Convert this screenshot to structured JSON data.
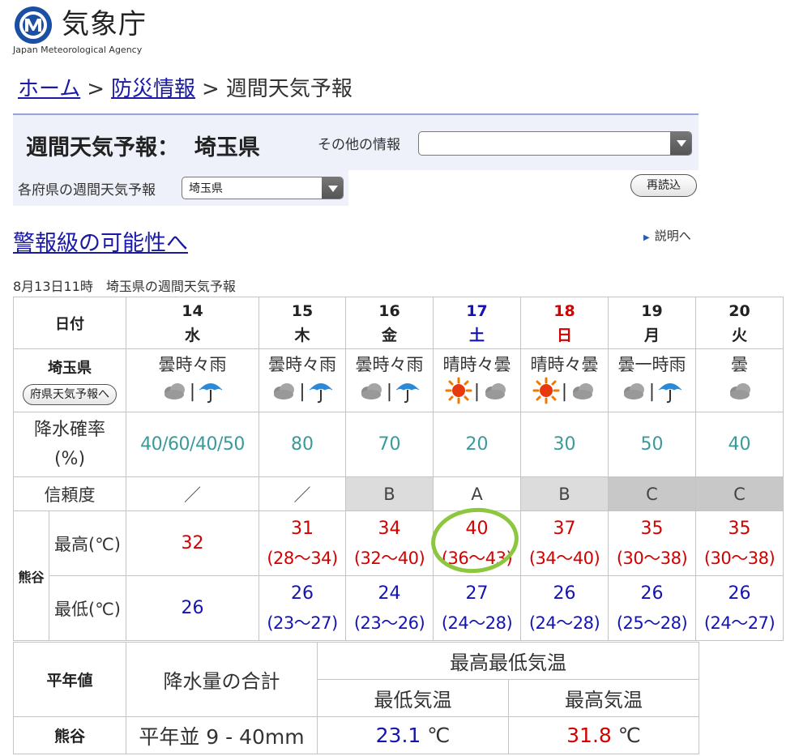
{
  "logo": {
    "jp": "気象庁",
    "en": "Japan Meteorological Agency"
  },
  "breadcrumb": {
    "home": "ホーム",
    "sep1": ">",
    "bosai": "防災情報",
    "sep2": ">",
    "current": "週間天気予報"
  },
  "header": {
    "title": "週間天気予報：  埼玉県",
    "other_info_label": "その他の情報",
    "other_info_value": "",
    "pref_label": "各府県の週間天気予報",
    "pref_value": "埼玉県",
    "reload": "再読込"
  },
  "warning_link": "警報級の可能性へ",
  "explain_link": "説明へ",
  "issued": "8月13日11時　埼玉県の週間天気予報",
  "forecast": {
    "date_label": "日付",
    "region": "埼玉県",
    "pref_forecast_button": "府県天気予報へ",
    "pop_label_1": "降水確率",
    "pop_label_2": "(%)",
    "reliability_label": "信頼度",
    "area": "熊谷",
    "max_label": "最高(℃)",
    "min_label": "最低(℃)",
    "days": [
      {
        "day": "14",
        "wd": "水",
        "color": "#222222",
        "weather": "曇時々雨",
        "icons": [
          "cloud-icon",
          "umbrella-icon"
        ],
        "pop": "40/60/40/50",
        "rel": "／",
        "max": "32",
        "max_range": "",
        "min": "26",
        "min_range": ""
      },
      {
        "day": "15",
        "wd": "木",
        "color": "#222222",
        "weather": "曇時々雨",
        "icons": [
          "cloud-icon",
          "umbrella-icon"
        ],
        "pop": "80",
        "rel": "／",
        "max": "31",
        "max_range": "(28～34)",
        "min": "26",
        "min_range": "(23～27)"
      },
      {
        "day": "16",
        "wd": "金",
        "color": "#222222",
        "weather": "曇時々雨",
        "icons": [
          "cloud-icon",
          "umbrella-icon"
        ],
        "pop": "70",
        "rel": "B",
        "max": "34",
        "max_range": "(32～40)",
        "min": "24",
        "min_range": "(23～26)"
      },
      {
        "day": "17",
        "wd": "土",
        "color": "#1414b4",
        "weather": "晴時々曇",
        "icons": [
          "sun-icon",
          "cloud-icon"
        ],
        "pop": "20",
        "rel": "A",
        "max": "40",
        "max_range": "(36～43)",
        "min": "27",
        "min_range": "(24～28)"
      },
      {
        "day": "18",
        "wd": "日",
        "color": "#d40000",
        "weather": "晴時々曇",
        "icons": [
          "sun-icon",
          "cloud-icon"
        ],
        "pop": "30",
        "rel": "B",
        "max": "37",
        "max_range": "(34～40)",
        "min": "26",
        "min_range": "(24～28)"
      },
      {
        "day": "19",
        "wd": "月",
        "color": "#222222",
        "weather": "曇一時雨",
        "icons": [
          "cloud-icon",
          "umbrella-icon"
        ],
        "pop": "50",
        "rel": "C",
        "max": "35",
        "max_range": "(30～38)",
        "min": "26",
        "min_range": "(25～28)"
      },
      {
        "day": "20",
        "wd": "火",
        "color": "#222222",
        "weather": "曇",
        "icons": [
          "cloud-icon"
        ],
        "pop": "40",
        "rel": "C",
        "max": "35",
        "max_range": "(30～38)",
        "min": "26",
        "min_range": "(24～27)"
      }
    ]
  },
  "normals": {
    "label": "平年値",
    "precip_header": "降水量の合計",
    "temp_header": "最高最低気温",
    "min_header": "最低気温",
    "max_header": "最高気温",
    "area": "熊谷",
    "precip": "平年並 9 - 40mm",
    "min_val": "23.1",
    "max_val": "31.8",
    "unit": "℃"
  },
  "colors": {
    "link": "#1a1aa6",
    "max_temp": "#d40000",
    "min_temp": "#1414b4",
    "pop": "#3a9a9a",
    "highlight": "#8dc63f"
  }
}
